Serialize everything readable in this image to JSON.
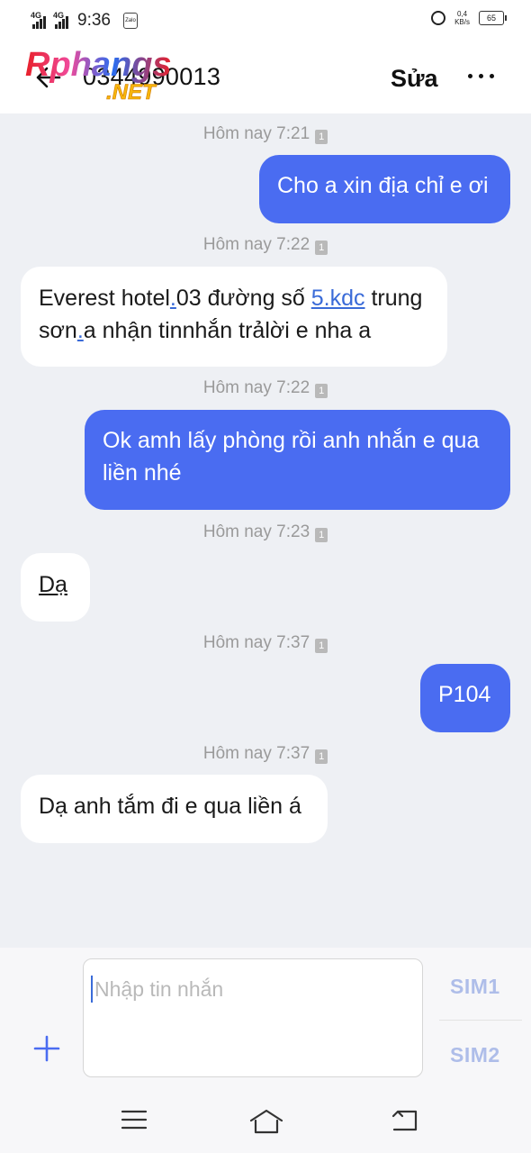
{
  "status_bar": {
    "network_1": "4G",
    "network_2": "4G",
    "time": "9:36",
    "app_icon_text": "Zalo",
    "speed_value": "0,4",
    "speed_unit": "KB/s",
    "battery": "65"
  },
  "header": {
    "contact": "0344990013",
    "edit_label": "Sửa",
    "watermark_main": "Rphangs",
    "watermark_sub": ".NET"
  },
  "messages": [
    {
      "time": "Hôm nay 7:21",
      "sim": "1",
      "dir": "out",
      "lines": [
        "Cho a xin địa chỉ e ơi"
      ]
    },
    {
      "time": "Hôm nay 7:22",
      "sim": "1",
      "dir": "in",
      "line1_a": "Everest hotel",
      "line1_b": ".",
      "line1_c": "03 đường số ",
      "line1_link": "5.kdc",
      "line1_d": " trung",
      "line2_a": "sơn",
      "line2_b": ".",
      "line2_c": "a nhận tinnhắn trảlời e nha a"
    },
    {
      "time": "Hôm nay 7:22",
      "sim": "1",
      "dir": "out",
      "lines": [
        "Ok amh lấy phòng rồi anh nhắn e qua",
        "liền nhé"
      ]
    },
    {
      "time": "Hôm nay 7:23",
      "sim": "1",
      "dir": "in",
      "lines": [
        "Dạ"
      ]
    },
    {
      "time": "Hôm nay 7:37",
      "sim": "1",
      "dir": "out",
      "lines": [
        "P104"
      ]
    },
    {
      "time": "Hôm nay 7:37",
      "sim": "1",
      "dir": "in",
      "lines": [
        "Dạ anh tắm đi e qua liền á"
      ]
    }
  ],
  "composer": {
    "placeholder": "Nhập tin nhắn",
    "sim1": "SIM1",
    "sim2": "SIM2"
  },
  "colors": {
    "outgoing_bubble": "#4a6cf1",
    "incoming_bubble": "#ffffff",
    "background": "#eef0f4",
    "link": "#3a6bd8"
  },
  "icons": [
    "back-arrow-icon",
    "more-dots-icon",
    "plus-icon",
    "menu-icon",
    "home-icon",
    "back-nav-icon",
    "alarm-icon",
    "battery-icon"
  ]
}
